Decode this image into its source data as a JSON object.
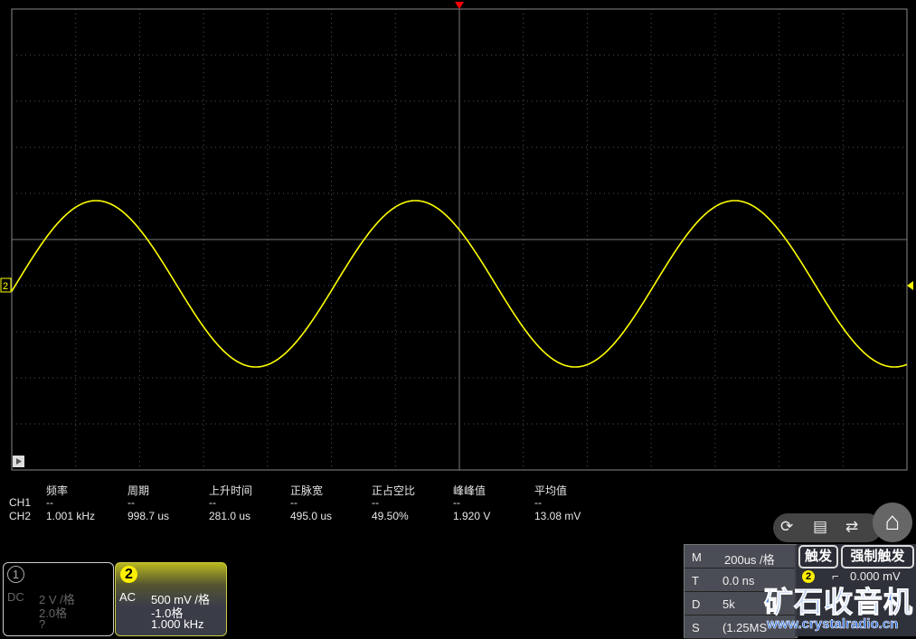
{
  "measurements": {
    "headers": [
      "频率",
      "周期",
      "上升时间",
      "正脉宽",
      "正占空比",
      "峰峰值",
      "平均值"
    ],
    "rows": [
      {
        "channel": "CH1",
        "values": [
          "--",
          "--",
          "--",
          "--",
          "--",
          "--",
          "--"
        ]
      },
      {
        "channel": "CH2",
        "values": [
          "1.001 kHz",
          "998.7 us",
          "281.0 us",
          "495.0 us",
          "49.50%",
          "1.920 V",
          "13.08 mV"
        ]
      }
    ]
  },
  "channels": [
    {
      "number": "1",
      "coupling": "DC",
      "scale": "2 V /格",
      "offset": "2.0格",
      "freq": "?"
    },
    {
      "number": "2",
      "coupling": "AC",
      "scale": "500 mV /格",
      "offset": "-1.0格",
      "freq": "1.000 kHz"
    }
  ],
  "timebase": {
    "M": "200us /格",
    "T": "0.0 ns",
    "D": "5k",
    "S": "(1.25MS"
  },
  "timebase_labels": {
    "M": "M",
    "T": "T",
    "D": "D",
    "S": "S"
  },
  "trigger": {
    "label": "触发",
    "force_label": "强制触发",
    "source": "2",
    "level": "0.000 mV"
  },
  "channel_marker": "2",
  "watermark": {
    "title": "矿石收音机",
    "url": "www.crystalradio.cn"
  },
  "colors": {
    "ch2": "#ffff00",
    "trigger": "#ff0000",
    "grid": "#666"
  }
}
